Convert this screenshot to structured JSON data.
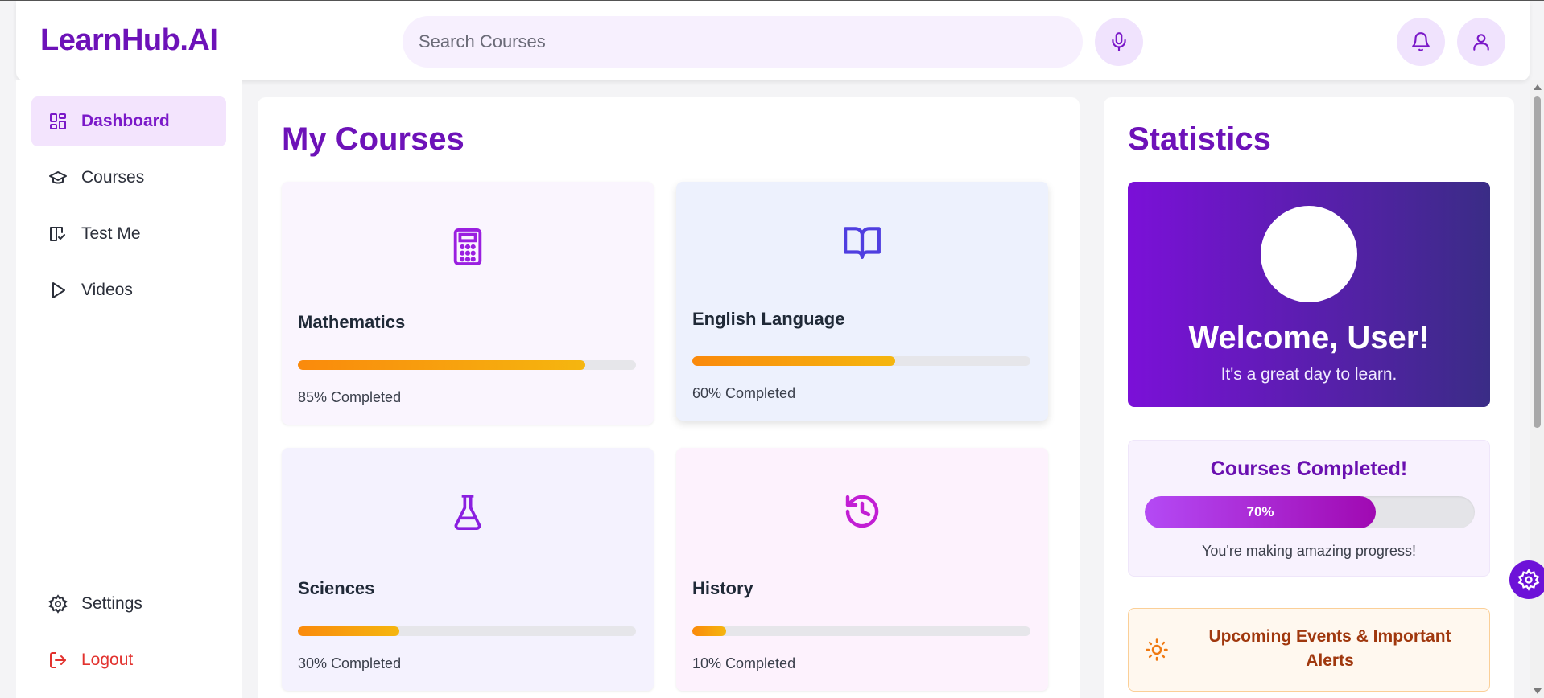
{
  "header": {
    "logo": "LearnHub.AI",
    "search_placeholder": "Search Courses",
    "mic_icon": "mic-icon",
    "bell_icon": "bell-icon",
    "user_icon": "user-icon"
  },
  "sidebar": {
    "items": [
      {
        "label": "Dashboard",
        "icon": "dashboard-icon",
        "active": true
      },
      {
        "label": "Courses",
        "icon": "graduation-cap-icon",
        "active": false
      },
      {
        "label": "Test Me",
        "icon": "book-check-icon",
        "active": false
      },
      {
        "label": "Videos",
        "icon": "play-icon",
        "active": false
      }
    ],
    "bottom": [
      {
        "label": "Settings",
        "icon": "gear-icon"
      },
      {
        "label": "Logout",
        "icon": "logout-icon"
      }
    ]
  },
  "courses": {
    "title": "My Courses",
    "cards": [
      {
        "name": "Mathematics",
        "progress": 85,
        "progress_label": "85% Completed",
        "icon": "calculator-icon",
        "bg": "#faf5fe"
      },
      {
        "name": "English Language",
        "progress": 60,
        "progress_label": "60% Completed",
        "icon": "book-open-icon",
        "bg": "#edf1fd"
      },
      {
        "name": "Sciences",
        "progress": 30,
        "progress_label": "30% Completed",
        "icon": "flask-icon",
        "bg": "#f4f2fe"
      },
      {
        "name": "History",
        "progress": 10,
        "progress_label": "10% Completed",
        "icon": "history-icon",
        "bg": "#fdf2fd"
      }
    ]
  },
  "stats": {
    "title": "Statistics",
    "welcome_title": "Welcome, User!",
    "welcome_sub": "It's a great day to learn.",
    "completed_title": "Courses Completed!",
    "completed_progress": 70,
    "completed_label": "70%",
    "progress_message": "You're making amazing progress!",
    "events_text": "Upcoming Events & Important Alerts",
    "events_icon": "sun-icon"
  },
  "colors": {
    "brand": "#6d12b8",
    "accent": "#7a18c8",
    "progress_start": "#fa8a0c",
    "progress_end": "#f5b60f",
    "logout": "#e2322e"
  }
}
